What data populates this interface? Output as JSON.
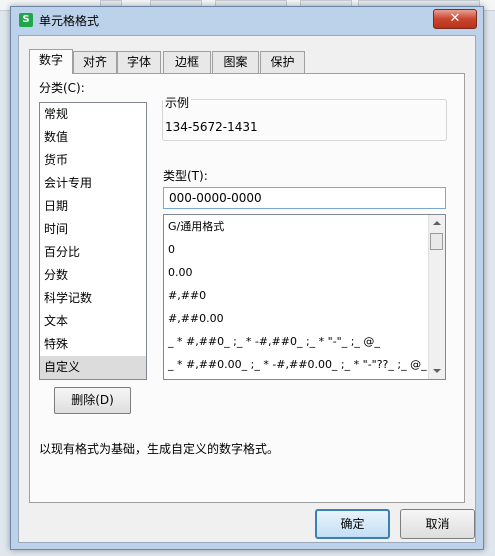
{
  "window": {
    "title": "单元格格式",
    "icon_letter": "S",
    "close_label": "✕"
  },
  "tabs": [
    {
      "label": "数字",
      "active": true
    },
    {
      "label": "对齐"
    },
    {
      "label": "字体"
    },
    {
      "label": "边框"
    },
    {
      "label": "图案"
    },
    {
      "label": "保护"
    }
  ],
  "category": {
    "label": "分类(C):",
    "items": [
      "常规",
      "数值",
      "货币",
      "会计专用",
      "日期",
      "时间",
      "百分比",
      "分数",
      "科学记数",
      "文本",
      "特殊",
      "自定义"
    ],
    "selected": "自定义"
  },
  "sample": {
    "legend": "示例",
    "value": "134-5672-1431"
  },
  "type": {
    "label": "类型(T):",
    "value": "000-0000-0000",
    "formats": [
      "G/通用格式",
      "0",
      "0.00",
      "#,##0",
      "#,##0.00",
      "_ * #,##0_ ;_ * -#,##0_ ;_ * \"-\"_ ;_ @_",
      "_ * #,##0.00_ ;_ * -#,##0.00_ ;_ * \"-\"??_ ;_ @_"
    ]
  },
  "buttons": {
    "delete": "删除(D)",
    "ok": "确定",
    "cancel": "取消"
  },
  "description": "以现有格式为基础，生成自定义的数字格式。",
  "colors": {
    "dialog_frame": "#bcd2ea",
    "close_button": "#c9452e",
    "selection": "#dcdcdc",
    "ok_border": "#3c7fb1"
  }
}
